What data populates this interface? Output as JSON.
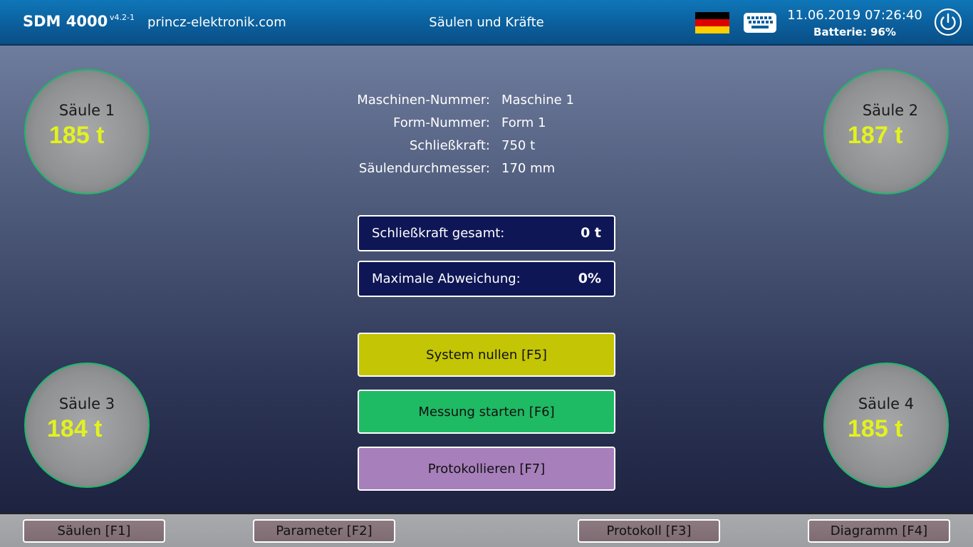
{
  "header": {
    "app_name": "SDM 4000",
    "version": "v4.2-1",
    "website": "princz-elektronik.com",
    "page_title": "Säulen und Kräfte",
    "language_icon": "german-flag-icon",
    "keyboard_icon": "keyboard-icon",
    "datetime": "11.06.2019 07:26:40",
    "battery": "Batterie: 96%",
    "power_icon": "power-icon"
  },
  "columns": [
    {
      "label": "Säule 1",
      "value": "185 t"
    },
    {
      "label": "Säule 2",
      "value": "187 t"
    },
    {
      "label": "Säule 3",
      "value": "184 t"
    },
    {
      "label": "Säule 4",
      "value": "185 t"
    }
  ],
  "info": [
    {
      "label": "Maschinen-Nummer:",
      "value": "Maschine 1"
    },
    {
      "label": "Form-Nummer:",
      "value": "Form 1"
    },
    {
      "label": "Schließkraft:",
      "value": "750 t"
    },
    {
      "label": "Säulendurchmesser:",
      "value": "170 mm"
    }
  ],
  "readouts": [
    {
      "label": "Schließkraft gesamt:",
      "value": "0 t"
    },
    {
      "label": "Maximale Abweichung:",
      "value": "0%"
    }
  ],
  "actions": [
    {
      "label": "System nullen [F5]",
      "color": "#c3c505"
    },
    {
      "label": "Messung starten [F6]",
      "color": "#1fba64"
    },
    {
      "label": "Protokollieren [F7]",
      "color": "#a77fbb"
    }
  ],
  "nav": [
    {
      "label": "Säulen [F1]"
    },
    {
      "label": "Parameter [F2]"
    },
    {
      "label": "Protokoll [F3]"
    },
    {
      "label": "Diagramm [F4]"
    }
  ],
  "colors": {
    "header_bg": "#0b5f9c",
    "gauge_border": "#1db86a",
    "gauge_value": "#e3f21d",
    "readout_bg": "#0e1655"
  }
}
